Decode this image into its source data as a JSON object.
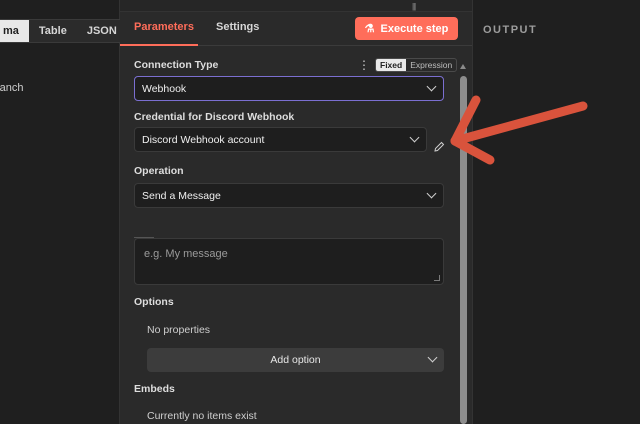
{
  "left_panel": {
    "tabs": [
      {
        "label": "ma",
        "active": true
      },
      {
        "label": "Table",
        "active": false
      },
      {
        "label": "JSON",
        "active": false
      }
    ],
    "branch_text": "ranch"
  },
  "center": {
    "tabs": {
      "parameters": "Parameters",
      "settings": "Settings"
    },
    "execute_button": "Execute step",
    "connection_type": {
      "label": "Connection Type",
      "value": "Webhook",
      "mode_fixed": "Fixed",
      "mode_expression": "Expression"
    },
    "credential": {
      "label": "Credential for Discord Webhook",
      "value": "Discord Webhook account"
    },
    "operation": {
      "label": "Operation",
      "value": "Send a Message"
    },
    "message": {
      "placeholder": "e.g. My message"
    },
    "options": {
      "label": "Options",
      "empty_text": "No properties",
      "add_button": "Add option"
    },
    "embeds": {
      "label": "Embeds",
      "empty_text": "Currently no items exist"
    }
  },
  "right_panel": {
    "title": "OUTPUT"
  },
  "colors": {
    "accent": "#ff6d5a",
    "annotation_arrow": "#d9533c",
    "focus_border": "#7b6fd1"
  }
}
